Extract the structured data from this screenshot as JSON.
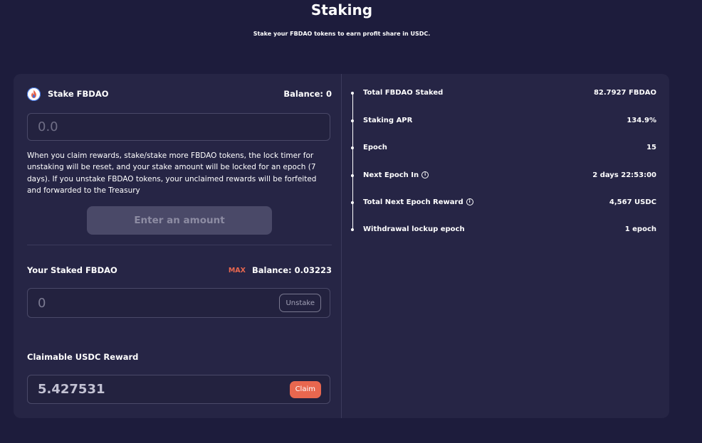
{
  "header": {
    "title": "Staking",
    "subtitle": "Stake your FBDAO tokens to earn profit share in USDC."
  },
  "stake": {
    "label": "Stake FBDAO",
    "balance_label": "Balance: 0",
    "input_placeholder": "0.0",
    "notice": "When you claim rewards, stake/stake more FBDAO tokens, the lock timer for unstaking will be reset, and your stake amount will be locked for an epoch (7 days). If you unstake FBDAO tokens, your unclaimed rewards will be forfeited and forwarded to the Treasury",
    "button_label": "Enter an amount"
  },
  "staked": {
    "label": "Your Staked FBDAO",
    "max_label": "MAX",
    "balance_label": "Balance: 0.03223",
    "input_value": "0",
    "button_label": "Unstake"
  },
  "reward": {
    "label": "Claimable USDC Reward",
    "value": "5.427531",
    "button_label": "Claim"
  },
  "stats": [
    {
      "label": "Total FBDAO Staked",
      "value": "82.7927 FBDAO",
      "info": false
    },
    {
      "label": "Staking APR",
      "value": "134.9%",
      "info": false
    },
    {
      "label": "Epoch",
      "value": "15",
      "info": false
    },
    {
      "label": "Next Epoch In",
      "value": "2 days 22:53:00",
      "info": true
    },
    {
      "label": "Total Next Epoch Reward",
      "value": "4,567 USDC",
      "info": true
    },
    {
      "label": "Withdrawal lockup epoch",
      "value": "1 epoch",
      "info": false
    }
  ],
  "icons": {
    "info": "info-icon",
    "token": "fbdao-token-icon"
  },
  "colors": {
    "background": "#1d1c3c",
    "card": "#262545",
    "accent": "#e8674f",
    "disabled_button": "#4a4968"
  }
}
